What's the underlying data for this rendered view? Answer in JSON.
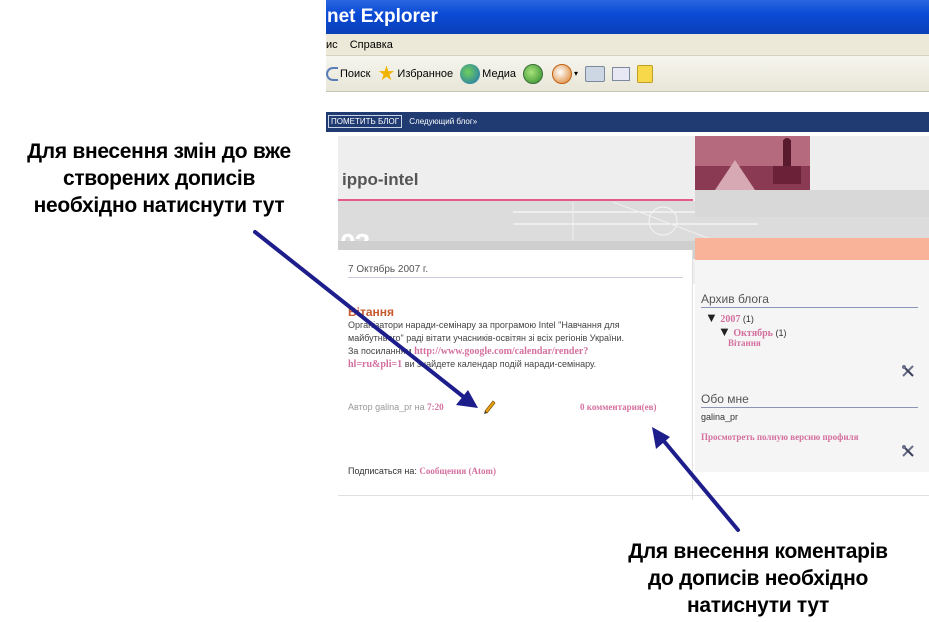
{
  "browser": {
    "title": "net Explorer",
    "menu": [
      "ис",
      "Справка"
    ],
    "toolbar": {
      "search": "Поиск",
      "favorites": "Избранное",
      "media": "Медиа"
    }
  },
  "blog": {
    "navbar": {
      "flag_button": "ПОМЕТИТЬ БЛОГ",
      "next_blog": "Следующий блог»"
    },
    "title": "ippo-intel",
    "header_deco": "03",
    "date": "7 Октябрь 2007 г.",
    "post": {
      "title": "Вітання",
      "body_line1": "Організатори наради-семінару за програмою Intel \"Навчання для",
      "body_line2": "майбутнього\" раді вітати учасників-освітян зі всіх регіонів України.",
      "body_line3_prefix": "За посиланням",
      "link_part1": "http://www.google.com/calendar/render?",
      "link_part2": "hl=ru&pli=1",
      "body_line4_suffix": "ви знайдете календар подій наради-семінару.",
      "author_label": "Автор galina_pr",
      "at_label": "на",
      "time": "7:20",
      "comments": "0 комментария(ев)"
    },
    "subscribe_label": "Подписаться на:",
    "subscribe_link": "Сообщения (Atom)",
    "sidebar": {
      "archive_title": "Архив блога",
      "year": "2007",
      "year_count": "(1)",
      "month": "Октябрь",
      "month_count": "(1)",
      "post_link": "Вітання",
      "about_title": "Обо мне",
      "username": "galina_pr",
      "profile_link": "Просмотреть полную версию профиля"
    }
  },
  "annotations": {
    "left_line1": "Для внесення змін до вже",
    "left_line2": "створених дописів",
    "left_line3": "необхідно натиснути тут",
    "right_line1": "Для внесення коментарів",
    "right_line2": "до дописів необхідно",
    "right_line3": "натиснути тут"
  },
  "colors": {
    "titlebar": "#0b4bd6",
    "navbar": "#1f3b72",
    "accent_pink": "#d4709f",
    "post_title": "#c65a2e",
    "arrow": "#1d1d8c"
  }
}
